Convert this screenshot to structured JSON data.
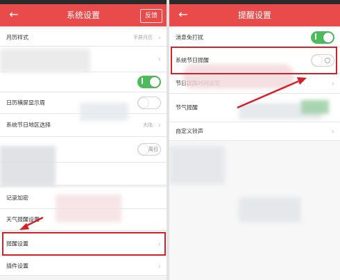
{
  "left": {
    "title": "系统设置",
    "feedback": "反馈",
    "rows": [
      {
        "label": "月历样式",
        "value": "半屏月历"
      },
      {
        "label": "日历横屏显示周"
      },
      {
        "label": "系统节日地区选择",
        "value": "大陆"
      },
      {
        "toggle_text": "周日"
      },
      {
        "label": "记录加密"
      },
      {
        "label": "天气提醒设置"
      },
      {
        "label": "提醒设置"
      },
      {
        "label": "插件设置"
      }
    ]
  },
  "right": {
    "title": "提醒设置",
    "rows": [
      {
        "label": "消息免打扰",
        "on": true
      },
      {
        "label": "系统节日提醒",
        "on": false
      },
      {
        "label": "节日提醒时间设定"
      },
      {
        "label": "节气提醒"
      },
      {
        "label": "自定义铃声"
      }
    ]
  },
  "colors": {
    "header": "#e94b4b",
    "toggle_on": "#4cbb5b",
    "highlight": "#d61f26"
  },
  "icons": [
    "back-arrow-icon",
    "chevron-right-icon",
    "toggle-switch-icon",
    "red-arrow-icon"
  ]
}
